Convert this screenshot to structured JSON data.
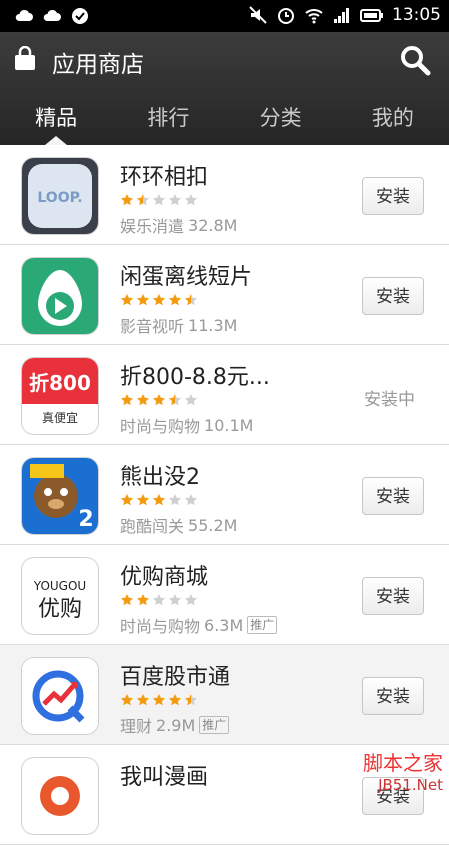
{
  "status_bar": {
    "time": "13:05",
    "left_icons": [
      "cloud-icon",
      "cloud-icon",
      "check-circle-icon"
    ],
    "right_icons": [
      "mute-icon",
      "alarm-icon",
      "wifi-icon",
      "signal-icon",
      "battery-icon"
    ]
  },
  "header": {
    "title": "应用商店",
    "tabs": [
      {
        "label": "精品",
        "active": true
      },
      {
        "label": "排行",
        "active": false
      },
      {
        "label": "分类",
        "active": false
      },
      {
        "label": "我的",
        "active": false
      }
    ]
  },
  "apps": [
    {
      "name": "环环相扣",
      "rating": 1.5,
      "category": "娱乐消遣",
      "size": "32.8M",
      "button": "安装",
      "ad": "",
      "status": "",
      "icon": {
        "name": "loop-app-icon",
        "text": "LOOP.",
        "bg": "#3a3f4a"
      }
    },
    {
      "name": "闲蛋离线短片",
      "rating": 4.5,
      "category": "影音视听",
      "size": "11.3M",
      "button": "安装",
      "ad": "",
      "status": "",
      "icon": {
        "name": "egg-play-app-icon",
        "text": "",
        "bg": "#2aa876"
      }
    },
    {
      "name": "折800-8.8元...",
      "rating": 3.5,
      "category": "时尚与购物",
      "size": "10.1M",
      "button": "",
      "ad": "",
      "status": "安装中",
      "icon": {
        "name": "zhe800-app-icon",
        "text": "折800",
        "sub": "真便宜",
        "bg": "#e8313a"
      }
    },
    {
      "name": "熊出没2",
      "rating": 3,
      "category": "跑酷闯关",
      "size": "55.2M",
      "button": "安装",
      "ad": "",
      "status": "",
      "icon": {
        "name": "bear-game-app-icon",
        "text": "2",
        "bg": "#1b6fd1"
      }
    },
    {
      "name": "优购商城",
      "rating": 2,
      "category": "时尚与购物",
      "size": "6.3M",
      "button": "安装",
      "ad": "推广",
      "status": "",
      "icon": {
        "name": "yougou-app-icon",
        "text": "YOUGOU",
        "sub": "优购",
        "bg": "#ffffff"
      }
    },
    {
      "name": "百度股市通",
      "rating": 4.5,
      "category": "理财",
      "size": "2.9M",
      "button": "安装",
      "ad": "推广",
      "status": "",
      "icon": {
        "name": "baidu-stock-app-icon",
        "text": "",
        "bg": "#ffffff"
      }
    },
    {
      "name": "我叫漫画",
      "rating": 0,
      "category": "",
      "size": "",
      "button": "安装",
      "ad": "",
      "status": "",
      "icon": {
        "name": "manhua-app-icon",
        "text": "",
        "bg": "#ffffff"
      }
    }
  ],
  "watermark": {
    "line1": "脚本之家",
    "line2": "JB51.Net"
  },
  "colors": {
    "star_on": "#f39c12",
    "star_off": "#d0d0d0",
    "header_bg": "#2e2e2e"
  }
}
